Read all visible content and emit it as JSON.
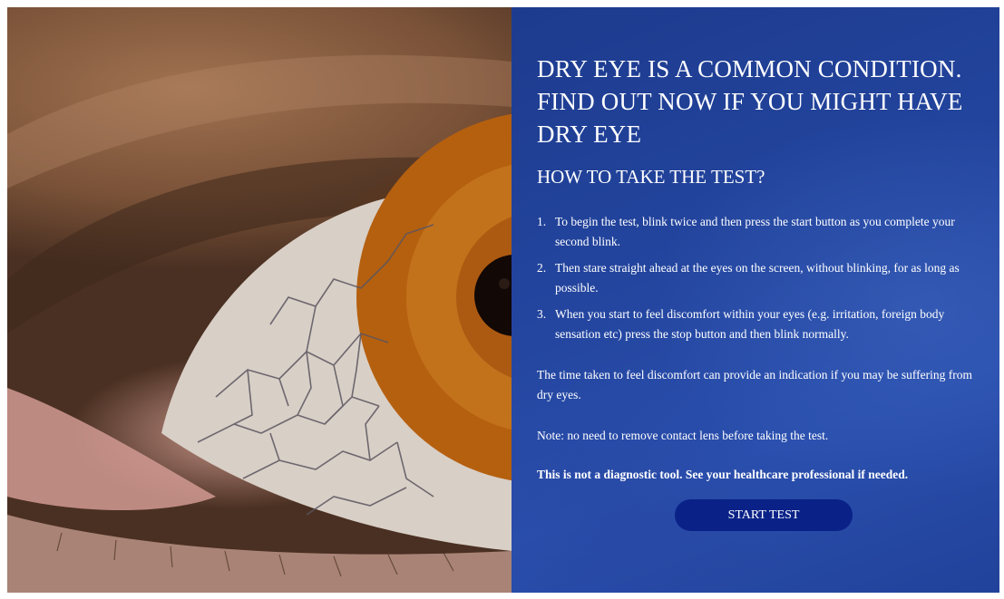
{
  "hero_image": {
    "alt": "",
    "icon": "cracked-dry-eye-illustration"
  },
  "panel": {
    "title": "DRY EYE IS A COMMON CONDITION. FIND OUT NOW IF YOU MIGHT HAVE DRY EYE",
    "subtitle": "HOW TO TAKE THE TEST?",
    "steps": [
      {
        "num": "1.",
        "text": "To begin the test, blink twice and then press the start button as you complete your second blink."
      },
      {
        "num": "2.",
        "text": "Then stare straight ahead at the eyes on the screen, without blinking, for as long as possible."
      },
      {
        "num": "3.",
        "text": "When you start to feel discomfort within your eyes (e.g. irritation, foreign body sensation etc) press the stop button and then blink normally."
      }
    ],
    "info_text": "The time taken to feel discomfort can provide an indication if you may be suffering from dry eyes.",
    "note_text": "Note: no need to remove contact lens before taking the test.",
    "disclaimer": "This is not a diagnostic tool. See your healthcare professional if needed.",
    "start_button_label": "START TEST"
  },
  "colors": {
    "panel_blue": "#2446a0",
    "button_blue": "#0a2288",
    "iris_orange": "#c26a16"
  }
}
